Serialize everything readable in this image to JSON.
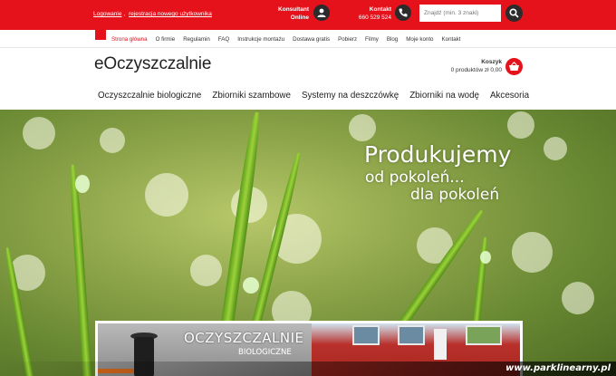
{
  "topbar": {
    "login": "Logowanie",
    "separator": ",",
    "register": "rejestracja nowego użytkownika",
    "consultant_line1": "Konsultant",
    "consultant_line2": "Online",
    "contact_label": "Kontakt",
    "contact_phone": "660 529 524",
    "search_placeholder": "Znajdź (min. 3 znaki)",
    "accent": "#e5121c"
  },
  "subnav": {
    "items": [
      "Strona główna",
      "O firmie",
      "Regulamin",
      "FAQ",
      "Instrukcje montażu",
      "Dostawa gratis",
      "Pobierz",
      "Filmy",
      "Blog",
      "Moje konto",
      "Kontakt"
    ]
  },
  "logo": {
    "text": "eOczyszczalnie"
  },
  "cart": {
    "label": "Koszyk",
    "summary": "0 produktów zł 0,00"
  },
  "mainnav": {
    "items": [
      "Oczyszczalnie biologiczne",
      "Zbiorniki szambowe",
      "Systemy na deszczówkę",
      "Zbiorniki na wodę",
      "Akcesoria"
    ]
  },
  "hero": {
    "line1": "Produkujemy",
    "line2": "od pokoleń...",
    "line3": "dla pokoleń"
  },
  "banner": {
    "title": "OCZYSZCZALNIE",
    "subtitle": "BIOLOGICZNE"
  },
  "watermark": {
    "text": "www.parklinearny.pl"
  },
  "icons": {
    "consultant": "user-icon",
    "contact": "phone-icon",
    "search": "search-icon",
    "cart": "basket-icon"
  }
}
